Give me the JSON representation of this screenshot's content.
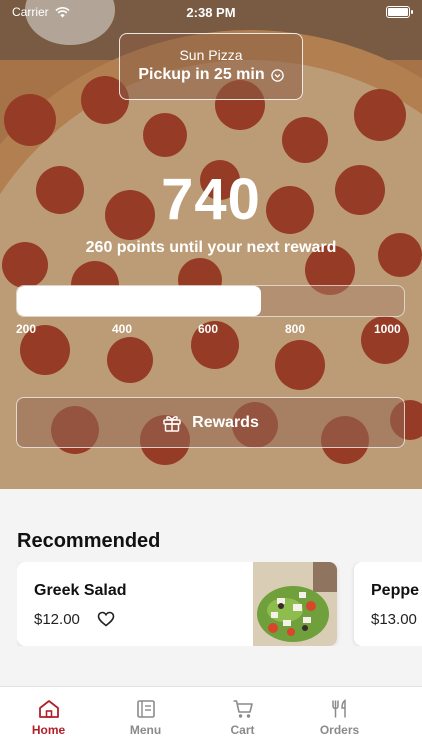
{
  "status_bar": {
    "carrier": "Carrier",
    "time": "2:38 PM"
  },
  "store": {
    "name": "Sun Pizza",
    "pickup": "Pickup in 25 min"
  },
  "loyalty": {
    "points": "740",
    "subtitle": "260 points until your next reward",
    "progress_fraction": 0.63,
    "ticks": [
      "200",
      "400",
      "600",
      "800",
      "1000"
    ]
  },
  "rewards_button": {
    "label": "Rewards"
  },
  "recommended": {
    "title": "Recommended",
    "items": [
      {
        "name": "Greek Salad",
        "price": "$12.00"
      },
      {
        "name": "Peppe",
        "price": "$13.00"
      }
    ]
  },
  "tabs": [
    {
      "label": "Home",
      "icon": "home-icon",
      "active": true
    },
    {
      "label": "Menu",
      "icon": "menu-icon",
      "active": false
    },
    {
      "label": "Cart",
      "icon": "cart-icon",
      "active": false
    },
    {
      "label": "Orders",
      "icon": "utensils-icon",
      "active": false
    }
  ],
  "colors": {
    "accent": "#b3202a",
    "hero_overlay": "#8c5f46"
  }
}
